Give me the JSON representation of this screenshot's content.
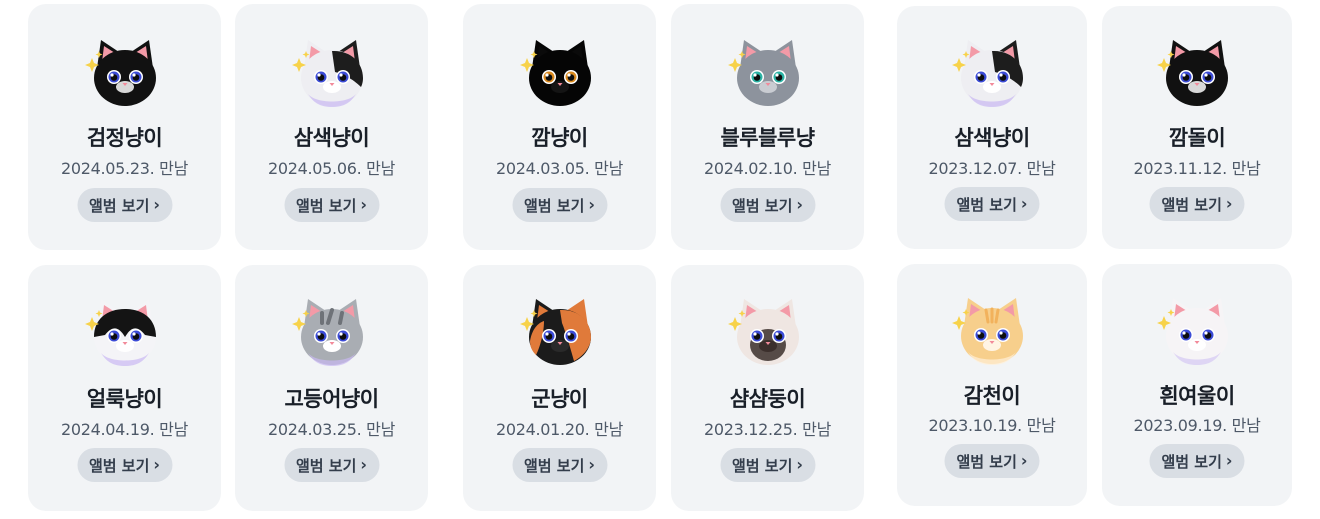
{
  "cats": [
    {
      "name": "검정냥이",
      "date": "2024.05.23. 만남",
      "button": "앨범 보기",
      "chevron": "›",
      "icon": "black-cat-icon",
      "colors": {
        "face": "#111111",
        "patch": "",
        "ear": "#f39aa7",
        "eye": "#3b4bd6",
        "muzzle": "#d8d8d8",
        "belly": "#111111"
      }
    },
    {
      "name": "삼색냥이",
      "date": "2024.05.06. 만남",
      "button": "앨범 보기",
      "chevron": "›",
      "icon": "calico-cat-icon",
      "colors": {
        "face": "#eeeef2",
        "patch": "#1d1d1d",
        "ear": "#f39aa7",
        "eye": "#3b4bd6",
        "muzzle": "#ffffff",
        "belly": "#c9b8f2"
      }
    },
    {
      "name": "깜냥이",
      "date": "2024.03.05. 만남",
      "button": "앨범 보기",
      "chevron": "›",
      "icon": "black-cat-icon",
      "colors": {
        "face": "#050505",
        "patch": "",
        "ear": "#0a0a0a",
        "eye": "#d9891e",
        "muzzle": "#141414",
        "belly": "#050505"
      }
    },
    {
      "name": "블루블루냥",
      "date": "2024.02.10. 만남",
      "button": "앨범 보기",
      "chevron": "›",
      "icon": "gray-cat-icon",
      "colors": {
        "face": "#8d939d",
        "patch": "",
        "ear": "#f39aa7",
        "eye": "#2bb3a5",
        "muzzle": "#c9ccd2",
        "belly": "#8d939d"
      }
    },
    {
      "name": "삼색냥이",
      "date": "2023.12.07. 만남",
      "button": "앨범 보기",
      "chevron": "›",
      "icon": "calico-cat-icon",
      "colors": {
        "face": "#eeeef2",
        "patch": "#1d1d1d",
        "ear": "#f39aa7",
        "eye": "#3b4bd6",
        "muzzle": "#ffffff",
        "belly": "#c9b8f2"
      }
    },
    {
      "name": "깜돌이",
      "date": "2023.11.12. 만남",
      "button": "앨범 보기",
      "chevron": "›",
      "icon": "black-cat-icon",
      "colors": {
        "face": "#111111",
        "patch": "",
        "ear": "#f39aa7",
        "eye": "#3b4bd6",
        "muzzle": "#d8d8d8",
        "belly": "#111111"
      }
    },
    {
      "name": "얼룩냥이",
      "date": "2024.04.19. 만남",
      "button": "앨범 보기",
      "chevron": "›",
      "icon": "tuxedo-cat-icon",
      "colors": {
        "face": "#f4f4f7",
        "patch": "#141414",
        "ear": "#f39aa7",
        "eye": "#3b4bd6",
        "muzzle": "#ffffff",
        "belly": "#c9b8f2"
      }
    },
    {
      "name": "고등어냥이",
      "date": "2024.03.25. 만남",
      "button": "앨범 보기",
      "chevron": "›",
      "icon": "tabby-cat-icon",
      "colors": {
        "face": "#a9adb3",
        "patch": "#6e7278",
        "ear": "#f39aa7",
        "eye": "#3b4bd6",
        "muzzle": "#ffffff",
        "belly": "#c9b8f2"
      }
    },
    {
      "name": "군냥이",
      "date": "2024.01.20. 만남",
      "button": "앨범 보기",
      "chevron": "›",
      "icon": "tortoiseshell-cat-icon",
      "colors": {
        "face": "#1b1b1b",
        "patch": "#e07a3a",
        "ear": "#e07a3a",
        "eye": "#3b4bd6",
        "muzzle": "#2a2a2a",
        "belly": "#1b1b1b"
      }
    },
    {
      "name": "샴샴둥이",
      "date": "2023.12.25. 만남",
      "button": "앨범 보기",
      "chevron": "›",
      "icon": "siamese-cat-icon",
      "colors": {
        "face": "#efe6e2",
        "patch": "#3b2f2c",
        "ear": "#f39aa7",
        "eye": "#3b4bd6",
        "muzzle": "#3b2f2c",
        "belly": "#efe6e2"
      }
    },
    {
      "name": "감천이",
      "date": "2023.10.19. 만남",
      "button": "앨범 보기",
      "chevron": "›",
      "icon": "orange-cat-icon",
      "colors": {
        "face": "#f7cf8c",
        "patch": "#f2b25c",
        "ear": "#f39aa7",
        "eye": "#3b4bd6",
        "muzzle": "#fff4e4",
        "belly": "#fff0d8"
      }
    },
    {
      "name": "흰여울이",
      "date": "2023.09.19. 만남",
      "button": "앨범 보기",
      "chevron": "›",
      "icon": "white-cat-icon",
      "colors": {
        "face": "#f6f4f6",
        "patch": "",
        "ear": "#f39aa7",
        "eye": "#3b4bd6",
        "muzzle": "#ffffff",
        "belly": "#d4c8f4"
      }
    }
  ],
  "sparkle_color": "#f7d24a",
  "nose_color": "#f28a9a"
}
